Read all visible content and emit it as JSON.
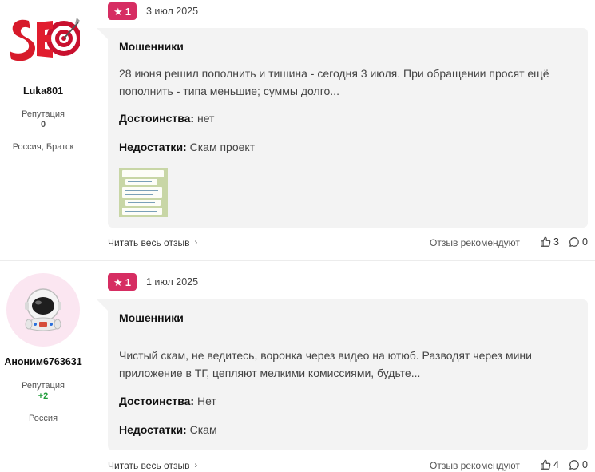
{
  "reviews": [
    {
      "author": {
        "name": "Luka801",
        "reputation_label": "Репутация",
        "reputation_value": "0",
        "location": "Россия, Братск",
        "avatar_icon": "seo-logo-icon"
      },
      "rating": "1",
      "date": "3 июл 2025",
      "title": "Мошенники",
      "text": "28 июня решил пополнить и тишина - сегодня 3 июля. При обращении просят ещё пополнить - типа меньшие; суммы долго...",
      "pros_label": "Достоинства:",
      "pros_value": "нет",
      "cons_label": "Недостатки:",
      "cons_value": "Скам проект",
      "has_attachment": true,
      "read_more": "Читать весь отзыв",
      "recommend_label": "Отзыв рекомендуют",
      "likes": "3",
      "comments": "0"
    },
    {
      "author": {
        "name": "Аноним6763631",
        "reputation_label": "Репутация",
        "reputation_value": "+2",
        "location": "Россия",
        "avatar_icon": "astronaut-icon"
      },
      "rating": "1",
      "date": "1 июл 2025",
      "title": "Мошенники",
      "text": "Чистый скам, не ведитесь, воронка через видео на ютюб. Разводят через мини приложение в ТГ, цепляют мелкими комиссиями, будьте...",
      "pros_label": "Достоинства:",
      "pros_value": "Нет",
      "cons_label": "Недостатки:",
      "cons_value": "Скам",
      "has_attachment": false,
      "read_more": "Читать весь отзыв",
      "recommend_label": "Отзыв рекомендуют",
      "likes": "4",
      "comments": "0"
    }
  ],
  "colors": {
    "badge": "#d62d62",
    "card_bg": "#f3f3f3",
    "positive_rep": "#1f9d3a"
  }
}
